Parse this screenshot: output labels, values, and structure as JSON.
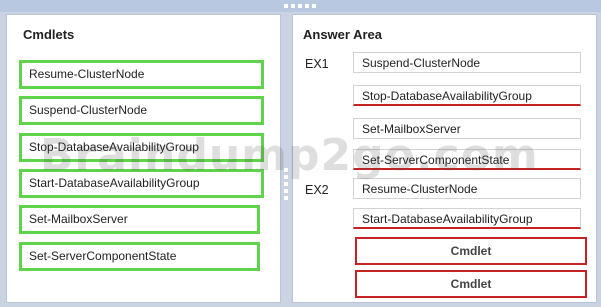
{
  "cmdlets": {
    "title": "Cmdlets",
    "items": [
      "Resume-ClusterNode",
      "Suspend-ClusterNode",
      "Stop-DatabaseAvailabilityGroup",
      "Start-DatabaseAvailabilityGroup",
      "Set-MailboxServer",
      "Set-ServerComponentState"
    ]
  },
  "answer_area": {
    "title": "Answer Area",
    "ex1": {
      "label": "EX1",
      "slots": [
        "Suspend-ClusterNode",
        "Stop-DatabaseAvailabilityGroup",
        "Set-MailboxServer",
        "Set-ServerComponentState"
      ]
    },
    "ex2": {
      "label": "EX2",
      "slots": [
        "Resume-ClusterNode",
        "Start-DatabaseAvailabilityGroup",
        "Cmdlet",
        "Cmdlet"
      ]
    }
  },
  "watermark": "Braindump2go.com",
  "colors": {
    "cmdlet_border": "#5fd34a",
    "answer_border": "#c62424",
    "background": "#c9d3e1"
  }
}
